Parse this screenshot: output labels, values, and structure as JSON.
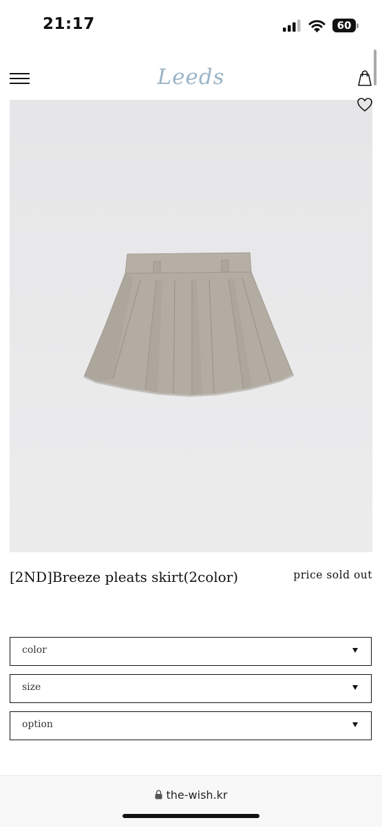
{
  "status_bar": {
    "time": "21:17",
    "battery": "60"
  },
  "header": {
    "logo": "Leeds"
  },
  "product": {
    "name": "[2ND]Breeze pleats skirt(2color)",
    "price": "price sold out"
  },
  "options": [
    {
      "label": "color"
    },
    {
      "label": "size"
    },
    {
      "label": "option"
    }
  ],
  "browser": {
    "url": "the-wish.kr"
  },
  "colors": {
    "logo": "#9bb4c6",
    "image_background": "#e9e9ea",
    "skirt": "#b3aca2"
  }
}
